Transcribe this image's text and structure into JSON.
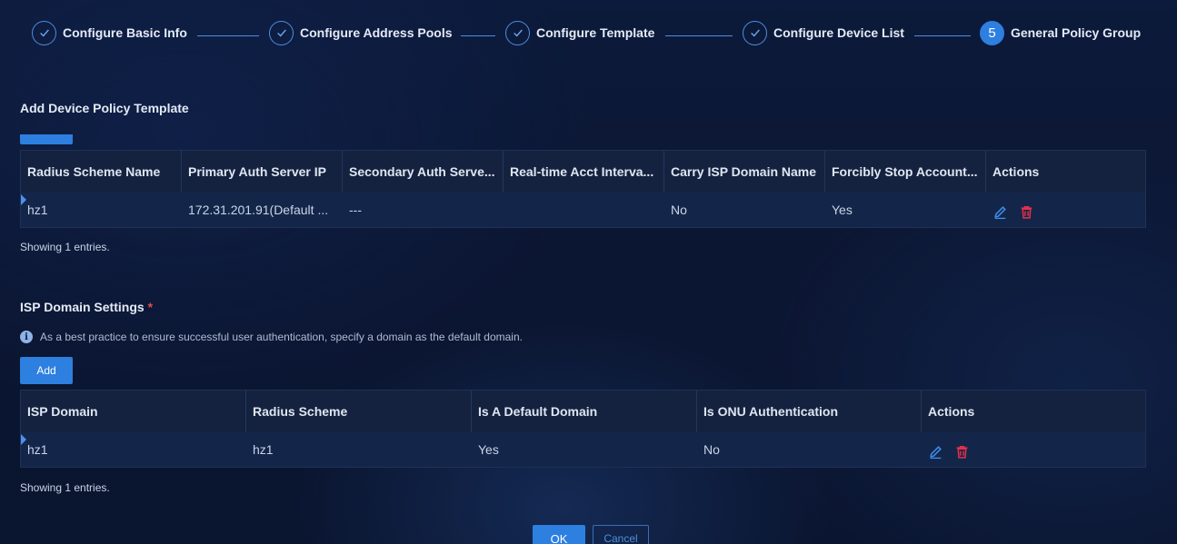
{
  "wizard": {
    "steps": [
      {
        "label": "Configure Basic Info",
        "state": "done"
      },
      {
        "label": "Configure Address Pools",
        "state": "done"
      },
      {
        "label": "Configure Template",
        "state": "done"
      },
      {
        "label": "Configure Device List",
        "state": "done"
      },
      {
        "label": "General Policy Group",
        "state": "active",
        "number": "5"
      }
    ]
  },
  "device_policy": {
    "title": "Add Device Policy Template",
    "columns": [
      "Radius Scheme Name",
      "Primary Auth Server IP",
      "Secondary Auth Serve...",
      "Real-time Acct Interva...",
      "Carry ISP Domain Name",
      "Forcibly Stop Account...",
      "Actions"
    ],
    "rows": [
      {
        "radius_scheme_name": "hz1",
        "primary_auth_ip": "172.31.201.91(Default ...",
        "secondary_auth": "---",
        "realtime_acct": "",
        "carry_isp": "No",
        "forcibly_stop": "Yes"
      }
    ],
    "showing": "Showing 1 entries."
  },
  "isp_domain": {
    "title": "ISP Domain Settings",
    "required_mark": "*",
    "info": "As a best practice to ensure successful user authentication, specify a domain as the default domain.",
    "add_label": "Add",
    "columns": [
      "ISP Domain",
      "Radius Scheme",
      "Is A Default Domain",
      "Is ONU Authentication",
      "Actions"
    ],
    "rows": [
      {
        "isp_domain": "hz1",
        "radius_scheme": "hz1",
        "is_default": "Yes",
        "is_onu": "No"
      }
    ],
    "showing": "Showing 1 entries."
  },
  "footer": {
    "ok_label": "OK",
    "cancel_label": "Cancel"
  },
  "icons": {
    "edit": "pencil-icon",
    "delete": "trash-icon",
    "check": "check-icon",
    "info": "info-icon"
  },
  "colors": {
    "accent": "#2d7fe0",
    "edit_icon": "#3f8ff0",
    "delete_icon": "#e8304a"
  }
}
